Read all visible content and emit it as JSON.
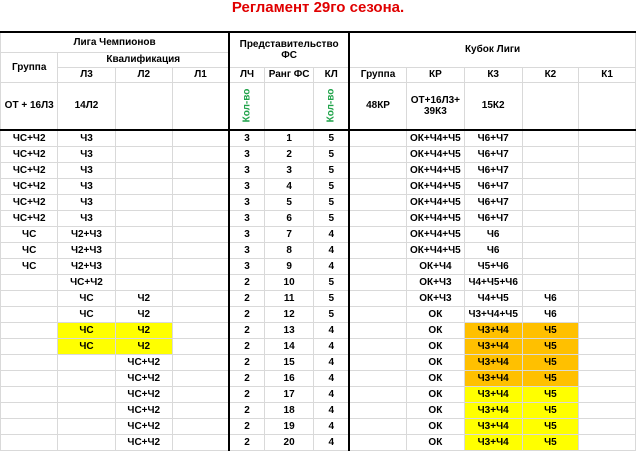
{
  "title": "Регламент 29го сезона.",
  "headers": {
    "champions_league": "Лига Чемпионов",
    "qualification": "Квалификация",
    "group": "Группа",
    "l3": "Л3",
    "l2": "Л2",
    "l1": "Л1",
    "representation_line1": "Представительство",
    "representation_line2": "ФС",
    "lch": "ЛЧ",
    "fs_rank": "Ранг ФС",
    "kl": "КЛ",
    "league_cup": "Кубок Лиги",
    "cup_group": "Группа",
    "kr": "КР",
    "k3": "К3",
    "k2": "К2",
    "k1": "К1"
  },
  "subheader": {
    "group": "ОТ + 16Л3",
    "l3": "14Л2",
    "count": "Кол-во",
    "count2": "Кол-во",
    "cup_group": "48КР",
    "kr_line1": "ОТ+16Л3+",
    "kr_line2": "39К3",
    "k3": "15К2"
  },
  "colors": {
    "title": "#e00000",
    "rank": "#1f6eb5",
    "green": "#20a34a",
    "yellow": "#ffff00",
    "orange": "#ffc000"
  },
  "rows": [
    {
      "group": "ЧС+Ч2",
      "l3": "Ч3",
      "l2": "",
      "l1": "",
      "lch": "3",
      "rank": "1",
      "kl": "5",
      "cupgroup": "",
      "kr": "ОК+Ч4+Ч5",
      "k3": "Ч6+Ч7",
      "k2": "",
      "k1": ""
    },
    {
      "group": "ЧС+Ч2",
      "l3": "Ч3",
      "l2": "",
      "l1": "",
      "lch": "3",
      "rank": "2",
      "kl": "5",
      "cupgroup": "",
      "kr": "ОК+Ч4+Ч5",
      "k3": "Ч6+Ч7",
      "k2": "",
      "k1": ""
    },
    {
      "group": "ЧС+Ч2",
      "l3": "Ч3",
      "l2": "",
      "l1": "",
      "lch": "3",
      "rank": "3",
      "kl": "5",
      "cupgroup": "",
      "kr": "ОК+Ч4+Ч5",
      "k3": "Ч6+Ч7",
      "k2": "",
      "k1": ""
    },
    {
      "group": "ЧС+Ч2",
      "l3": "Ч3",
      "l2": "",
      "l1": "",
      "lch": "3",
      "rank": "4",
      "kl": "5",
      "cupgroup": "",
      "kr": "ОК+Ч4+Ч5",
      "k3": "Ч6+Ч7",
      "k2": "",
      "k1": ""
    },
    {
      "group": "ЧС+Ч2",
      "l3": "Ч3",
      "l2": "",
      "l1": "",
      "lch": "3",
      "rank": "5",
      "kl": "5",
      "cupgroup": "",
      "kr": "ОК+Ч4+Ч5",
      "k3": "Ч6+Ч7",
      "k2": "",
      "k1": ""
    },
    {
      "group": "ЧС+Ч2",
      "l3": "Ч3",
      "l2": "",
      "l1": "",
      "lch": "3",
      "rank": "6",
      "kl": "5",
      "cupgroup": "",
      "kr": "ОК+Ч4+Ч5",
      "k3": "Ч6+Ч7",
      "k2": "",
      "k1": ""
    },
    {
      "group": "ЧС",
      "l3": "Ч2+Ч3",
      "l2": "",
      "l1": "",
      "lch": "3",
      "rank": "7",
      "kl": "4",
      "cupgroup": "",
      "kr": "ОК+Ч4+Ч5",
      "k3": "Ч6",
      "k2": "",
      "k1": ""
    },
    {
      "group": "ЧС",
      "l3": "Ч2+Ч3",
      "l2": "",
      "l1": "",
      "lch": "3",
      "rank": "8",
      "kl": "4",
      "cupgroup": "",
      "kr": "ОК+Ч4+Ч5",
      "k3": "Ч6",
      "k2": "",
      "k1": ""
    },
    {
      "group": "ЧС",
      "l3": "Ч2+Ч3",
      "l2": "",
      "l1": "",
      "lch": "3",
      "rank": "9",
      "kl": "4",
      "cupgroup": "",
      "kr": "ОК+Ч4",
      "k3": "Ч5+Ч6",
      "k2": "",
      "k1": ""
    },
    {
      "group": "",
      "l3": "ЧС+Ч2",
      "l2": "",
      "l1": "",
      "lch": "2",
      "rank": "10",
      "kl": "5",
      "cupgroup": "",
      "kr": "ОК+Ч3",
      "k3": "Ч4+Ч5+Ч6",
      "k2": "",
      "k1": ""
    },
    {
      "group": "",
      "l3": "ЧС",
      "l2": "Ч2",
      "l1": "",
      "lch": "2",
      "rank": "11",
      "kl": "5",
      "cupgroup": "",
      "kr": "ОК+Ч3",
      "k3": "Ч4+Ч5",
      "k2": "Ч6",
      "k1": ""
    },
    {
      "group": "",
      "l3": "ЧС",
      "l2": "Ч2",
      "l1": "",
      "lch": "2",
      "rank": "12",
      "kl": "5",
      "cupgroup": "",
      "kr": "ОК",
      "k3": "Ч3+Ч4+Ч5",
      "k2": "Ч6",
      "k1": ""
    },
    {
      "group": "",
      "l3": "ЧС",
      "l2": "Ч2",
      "l1": "",
      "lch": "2",
      "rank": "13",
      "kl": "4",
      "cupgroup": "",
      "kr": "ОК",
      "k3": "Ч3+Ч4",
      "k2": "Ч5",
      "k1": "",
      "hl": "y",
      "kh": "o"
    },
    {
      "group": "",
      "l3": "ЧС",
      "l2": "Ч2",
      "l1": "",
      "lch": "2",
      "rank": "14",
      "kl": "4",
      "cupgroup": "",
      "kr": "ОК",
      "k3": "Ч3+Ч4",
      "k2": "Ч5",
      "k1": "",
      "hl": "y",
      "kh": "o"
    },
    {
      "group": "",
      "l3": "",
      "l2": "ЧС+Ч2",
      "l1": "",
      "lch": "2",
      "rank": "15",
      "kl": "4",
      "cupgroup": "",
      "kr": "ОК",
      "k3": "Ч3+Ч4",
      "k2": "Ч5",
      "k1": "",
      "kh": "o"
    },
    {
      "group": "",
      "l3": "",
      "l2": "ЧС+Ч2",
      "l1": "",
      "lch": "2",
      "rank": "16",
      "kl": "4",
      "cupgroup": "",
      "kr": "ОК",
      "k3": "Ч3+Ч4",
      "k2": "Ч5",
      "k1": "",
      "kh": "o"
    },
    {
      "group": "",
      "l3": "",
      "l2": "ЧС+Ч2",
      "l1": "",
      "lch": "2",
      "rank": "17",
      "kl": "4",
      "cupgroup": "",
      "kr": "ОК",
      "k3": "Ч3+Ч4",
      "k2": "Ч5",
      "k1": "",
      "kh": "y"
    },
    {
      "group": "",
      "l3": "",
      "l2": "ЧС+Ч2",
      "l1": "",
      "lch": "2",
      "rank": "18",
      "kl": "4",
      "cupgroup": "",
      "kr": "ОК",
      "k3": "Ч3+Ч4",
      "k2": "Ч5",
      "k1": "",
      "kh": "y"
    },
    {
      "group": "",
      "l3": "",
      "l2": "ЧС+Ч2",
      "l1": "",
      "lch": "2",
      "rank": "19",
      "kl": "4",
      "cupgroup": "",
      "kr": "ОК",
      "k3": "Ч3+Ч4",
      "k2": "Ч5",
      "k1": "",
      "kh": "y"
    },
    {
      "group": "",
      "l3": "",
      "l2": "ЧС+Ч2",
      "l1": "",
      "lch": "2",
      "rank": "20",
      "kl": "4",
      "cupgroup": "",
      "kr": "ОК",
      "k3": "Ч3+Ч4",
      "k2": "Ч5",
      "k1": "",
      "kh": "y"
    }
  ]
}
